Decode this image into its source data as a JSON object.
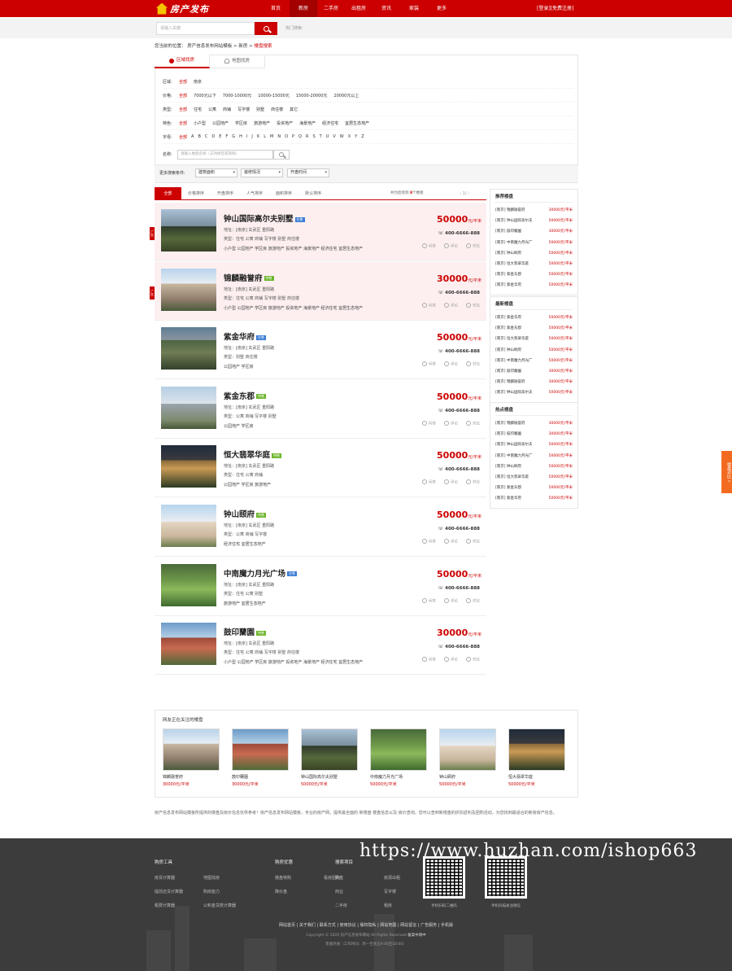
{
  "header": {
    "logo_text": "房产发布",
    "nav": [
      "首页",
      "新房",
      "二手房",
      "出租房",
      "资讯",
      "家装",
      "更多"
    ],
    "active_nav": 1,
    "login": "[登录]",
    "register": "[免费注册]"
  },
  "search": {
    "placeholder": "请输入关键",
    "hot_label": "热门搜索:"
  },
  "breadcrumb": {
    "prefix": "您当前的位置：",
    "site": "房产信息发布网站模板",
    "sep": ">",
    "section": "新房",
    "current": "楼盘搜索"
  },
  "filter_tabs": [
    "区域找房",
    "地图找房"
  ],
  "filters": [
    {
      "label": "区域:",
      "options": [
        "全部",
        "南京"
      ],
      "selected": 0
    },
    {
      "label": "价格:",
      "options": [
        "全部",
        "7000元以下",
        "7000-10000元",
        "10000-15000元",
        "15000-20000元",
        "20000元以上"
      ],
      "selected": 0
    },
    {
      "label": "类型:",
      "options": [
        "全部",
        "住宅",
        "公寓",
        "商铺",
        "写字楼",
        "别墅",
        "商住楼",
        "其它"
      ],
      "selected": 0
    },
    {
      "label": "特色:",
      "options": [
        "全部",
        "小户型",
        "公园地产",
        "学区房",
        "旅游地产",
        "投资地产",
        "海景地产",
        "经济住宅",
        "宜居生态地产"
      ],
      "selected": 0
    },
    {
      "label": "字母:",
      "options": [
        "全部",
        "A",
        "B",
        "C",
        "D",
        "E",
        "F",
        "G",
        "H",
        "I",
        "J",
        "K",
        "L",
        "M",
        "N",
        "O",
        "P",
        "Q",
        "R",
        "S",
        "T",
        "U",
        "V",
        "W",
        "X",
        "Y",
        "Z"
      ],
      "selected": 0
    }
  ],
  "name_search": {
    "label": "名称:",
    "placeholder": "请输入楼盘名称（支持拼音或简称）"
  },
  "sort": {
    "label": "更多搜索条件:",
    "selects": [
      "建筑面积",
      "装修情况",
      "开盘时间"
    ]
  },
  "list_tabs": [
    "全部",
    "价格排序",
    "开盘排序",
    "人气排序",
    "面积排序",
    "默认排序"
  ],
  "list_count": {
    "prefix": "共为您找到",
    "count": "8",
    "suffix": "个楼盘"
  },
  "pager": "‹  1/  ›",
  "listings": [
    {
      "name": "钟山国际高尔夫别墅",
      "badge": "在售",
      "badge_color": "blue",
      "addr": "地址：[南京]  玄武区    重阳路",
      "type": "类型：住宅 公寓 商铺 写字楼 别墅 商住楼",
      "tags": "小户型 公园地产 学区房 旅游地产 投资地产 海景地产 经济住宅 宜居生态地产",
      "price": "50000",
      "unit": "元/平米",
      "phone": "400-6666-888",
      "acts": [
        "问答",
        "评论",
        "对比"
      ],
      "highlight": true,
      "ad": "广告"
    },
    {
      "name": "锦麟融誉府",
      "badge": "待售",
      "badge_color": "green",
      "addr": "地址：[南京]  玄武区    重阳路",
      "type": "类型：住宅 公寓 商铺 写字楼 别墅 商住楼",
      "tags": "小户型 公园地产 学区房 旅游地产 投资地产 海景地产 经济住宅 宜居生态地产",
      "price": "30000",
      "unit": "元/平米",
      "phone": "400-6666-888",
      "acts": [
        "问答",
        "评论",
        "对比"
      ],
      "highlight": true,
      "ad": "广告"
    },
    {
      "name": "紫金华府",
      "badge": "在售",
      "badge_color": "blue",
      "addr": "地址：[南京]  玄武区    重阳路",
      "type": "类型：别墅 商住楼",
      "tags": "公园地产 学区房",
      "price": "50000",
      "unit": "元/平米",
      "phone": "400-6666-888",
      "acts": [
        "问答",
        "评论",
        "对比"
      ],
      "highlight": false,
      "ad": ""
    },
    {
      "name": "紫金东郡",
      "badge": "待售",
      "badge_color": "green",
      "addr": "地址：[南京]  玄武区    重阳路",
      "type": "类型：公寓 商铺 写字楼 别墅",
      "tags": "公园地产 学区房",
      "price": "50000",
      "unit": "元/平米",
      "phone": "400-6666-888",
      "acts": [
        "问答",
        "评论",
        "对比"
      ],
      "highlight": false,
      "ad": ""
    },
    {
      "name": "恒大翡翠华庭",
      "badge": "待售",
      "badge_color": "green",
      "addr": "地址：[南京]  玄武区    重阳路",
      "type": "类型：住宅 公寓 商铺",
      "tags": "公园地产 学区房 旅游地产",
      "price": "50000",
      "unit": "元/平米",
      "phone": "400-6666-888",
      "acts": [
        "问答",
        "评论",
        "对比"
      ],
      "highlight": false,
      "ad": ""
    },
    {
      "name": "钟山颐府",
      "badge": "待售",
      "badge_color": "green",
      "addr": "地址：[南京]  玄武区    重阳路",
      "type": "类型：公寓 商铺 写字楼",
      "tags": "经济住宅 宜居生态地产",
      "price": "50000",
      "unit": "元/平米",
      "phone": "400-6666-888",
      "acts": [
        "问答",
        "评论",
        "对比"
      ],
      "highlight": false,
      "ad": ""
    },
    {
      "name": "中南魔力月光广场",
      "badge": "在售",
      "badge_color": "blue",
      "addr": "地址：[南京]  玄武区    重阳路",
      "type": "类型：住宅 公寓 别墅",
      "tags": "旅游地产 宜居生态地产",
      "price": "50000",
      "unit": "元/平米",
      "phone": "400-6666-888",
      "acts": [
        "问答",
        "评论",
        "对比"
      ],
      "highlight": false,
      "ad": ""
    },
    {
      "name": "鼓印蘭園",
      "badge": "待售",
      "badge_color": "green",
      "addr": "地址：[南京]  玄武区    重阳路",
      "type": "类型：住宅 公寓 商铺 写字楼 别墅 商住楼",
      "tags": "小户型 公园地产 学区房 旅游地产 投资地产 海景地产 经济住宅 宜居生态地产",
      "price": "30000",
      "unit": "元/平米",
      "phone": "400-6666-888",
      "acts": [
        "问答",
        "评论",
        "对比"
      ],
      "highlight": false,
      "ad": ""
    }
  ],
  "sidebar": [
    {
      "title": "推荐楼盘",
      "rows": [
        [
          "[南京] 锦麟融誉府",
          "30000元/平米"
        ],
        [
          "[南京] 钟山国际高尔夫",
          "50000元/平米"
        ],
        [
          "[南京] 鼓印蘭園",
          "30000元/平米"
        ],
        [
          "[南京] 中南魔力月光广",
          "50000元/平米"
        ],
        [
          "[南京] 钟山颐府",
          "50000元/平米"
        ],
        [
          "[南京] 恒大翡翠华庭",
          "50000元/平米"
        ],
        [
          "[南京] 紫金东郡",
          "50000元/平米"
        ],
        [
          "[南京] 紫金华府",
          "50000元/平米"
        ]
      ]
    },
    {
      "title": "最新楼盘",
      "rows": [
        [
          "[南京] 紫金华府",
          "50000元/平米"
        ],
        [
          "[南京] 紫金东郡",
          "50000元/平米"
        ],
        [
          "[南京] 恒大翡翠华庭",
          "50000元/平米"
        ],
        [
          "[南京] 钟山颐府",
          "50000元/平米"
        ],
        [
          "[南京] 中南魔力月光广",
          "50000元/平米"
        ],
        [
          "[南京] 鼓印蘭園",
          "30000元/平米"
        ],
        [
          "[南京] 锦麟融誉府",
          "30000元/平米"
        ],
        [
          "[南京] 钟山国际高尔夫",
          "50000元/平米"
        ]
      ]
    },
    {
      "title": "热点楼盘",
      "rows": [
        [
          "[南京] 锦麟融誉府",
          "30000元/平米"
        ],
        [
          "[南京] 鼓印蘭園",
          "30000元/平米"
        ],
        [
          "[南京] 钟山国际高尔夫",
          "50000元/平米"
        ],
        [
          "[南京] 中南魔力月光广",
          "50000元/平米"
        ],
        [
          "[南京] 钟山颐府",
          "50000元/平米"
        ],
        [
          "[南京] 恒大翡翠华庭",
          "50000元/平米"
        ],
        [
          "[南京] 紫金东郡",
          "50000元/平米"
        ],
        [
          "[南京] 紫金华府",
          "50000元/平米"
        ]
      ]
    }
  ],
  "float_btn": "楼盘对比 «",
  "related": {
    "title": "网友正在关注的楼盘",
    "items": [
      [
        "锦麟融誉府",
        "30000元/平米"
      ],
      [
        "鼓印蘭園",
        "30000元/平米"
      ],
      [
        "钟山国际高尔夫别墅",
        "50000元/平米"
      ],
      [
        "中南魔力月光广场",
        "50000元/平米"
      ],
      [
        "钟山颐府",
        "50000元/平米"
      ],
      [
        "恒大翡翠华庭",
        "50000元/平米"
      ]
    ]
  },
  "disclaimer": "房产信息发布网站模板所提供的楼盘及房价信息仅供参考！房产信息发布网站模板，专业的房产网，提供最全面的 新楼盘 楼盘信息以及 房价查询，您可以查到新楼盘的折扣返利及团购活动，为您找到最适合的新房房产信息。",
  "footer": {
    "cols": [
      {
        "title": "购房工具",
        "links": [
          "房贷计算器",
          "地图找房",
          "提前还贷计算器",
          "购房能力",
          "税费计算器",
          "公积金贷款计算器"
        ]
      },
      {
        "title": "购房优惠",
        "links": [
          "楼盘特购",
          "看房团购",
          "降价盘"
        ]
      },
      {
        "title": "搜索项目",
        "links": [
          "新盘",
          "房源出租",
          "商业",
          "写字楼",
          "二手房",
          "租房"
        ]
      }
    ],
    "qr_captions": [
      "手机扫码二维码",
      "手机扫描关注微信"
    ],
    "watermark": "https://www.huzhan.com/ishop663",
    "links": "网站首页 | 关于我们 | 联系方式 | 使用协议 | 版权隐私 | 网站地图 | 网站留言 | 广告服务 | 手机版",
    "copyright": "Copyright © 2020 房产信息发布网站 All Rights Reserved",
    "icp": "备案中请中",
    "hotline": "客服热线（工作时间：周一至周五9:00至18:00）"
  }
}
